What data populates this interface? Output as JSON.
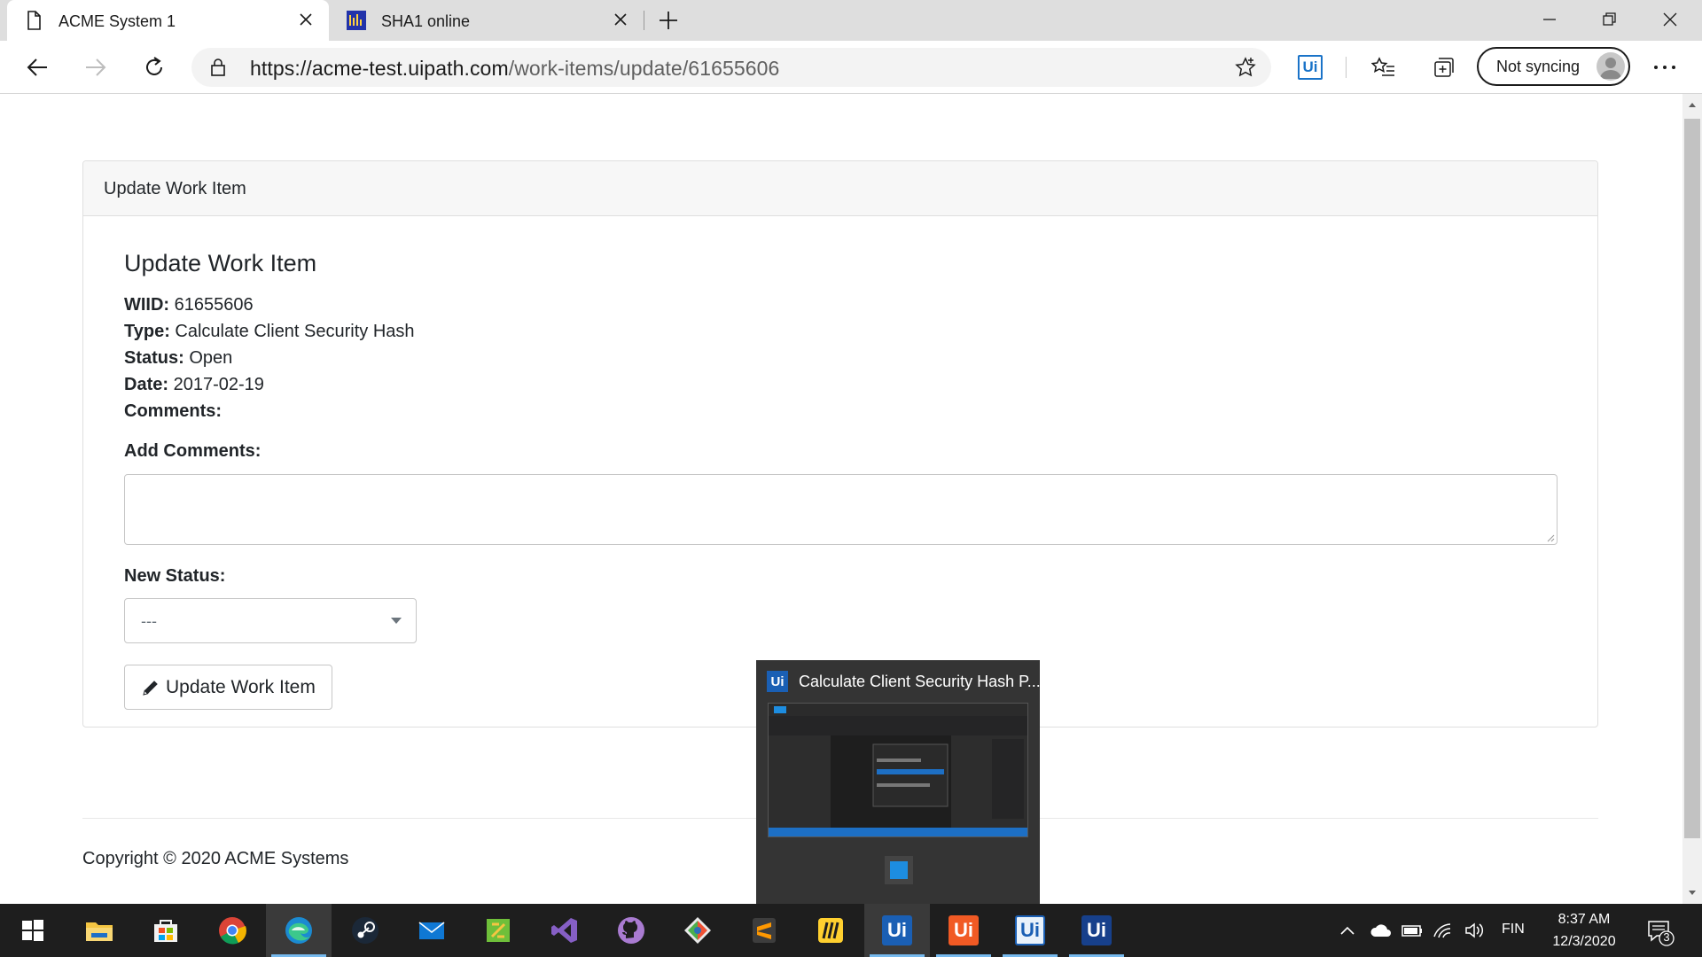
{
  "browser": {
    "tabs": [
      {
        "title": "ACME System 1",
        "active": true
      },
      {
        "title": "SHA1 online",
        "active": false
      }
    ],
    "url_host": "https://acme-test.uipath.com",
    "url_path": "/work-items/update/61655606",
    "extension_label": "Ui",
    "sync_label": "Not syncing"
  },
  "page": {
    "card_header": "Update Work Item",
    "title": "Update Work Item",
    "fields": [
      {
        "label": "WIID:",
        "value": "61655606"
      },
      {
        "label": "Type:",
        "value": "Calculate Client Security Hash"
      },
      {
        "label": "Status:",
        "value": "Open"
      },
      {
        "label": "Date:",
        "value": "2017-02-19"
      },
      {
        "label": "Comments:",
        "value": ""
      }
    ],
    "add_comments_label": "Add Comments:",
    "add_comments_value": "",
    "new_status_label": "New Status:",
    "new_status_selected": "---",
    "update_button_label": "Update Work Item",
    "footer": "Copyright © 2020 ACME Systems"
  },
  "preview": {
    "icon_label": "Ui",
    "title": "Calculate Client Security Hash P..."
  },
  "taskbar": {
    "apps": [
      {
        "name": "start",
        "glyph": ""
      },
      {
        "name": "file-explorer",
        "glyph": ""
      },
      {
        "name": "microsoft-store",
        "glyph": ""
      },
      {
        "name": "chrome",
        "glyph": ""
      },
      {
        "name": "edge",
        "glyph": ""
      },
      {
        "name": "steam",
        "glyph": ""
      },
      {
        "name": "mail",
        "glyph": ""
      },
      {
        "name": "app-green",
        "glyph": ""
      },
      {
        "name": "visual-studio",
        "glyph": ""
      },
      {
        "name": "github-desktop",
        "glyph": ""
      },
      {
        "name": "git-tool",
        "glyph": ""
      },
      {
        "name": "sublime-text",
        "glyph": ""
      },
      {
        "name": "miro",
        "glyph": ""
      },
      {
        "name": "uipath-studio",
        "glyph": "Ui"
      },
      {
        "name": "uipath-studio-orange",
        "glyph": "Ui"
      },
      {
        "name": "uipath-assistant",
        "glyph": "Ui"
      },
      {
        "name": "uipath-robot",
        "glyph": "Ui"
      }
    ],
    "language": "FIN",
    "time": "8:37 AM",
    "date": "12/3/2020",
    "notification_count": "3"
  },
  "colors": {
    "accent": "#1a73c8",
    "taskbar": "#1e1e1e",
    "uipath_blue": "#1a5fb4",
    "uipath_orange": "#f15a24"
  }
}
